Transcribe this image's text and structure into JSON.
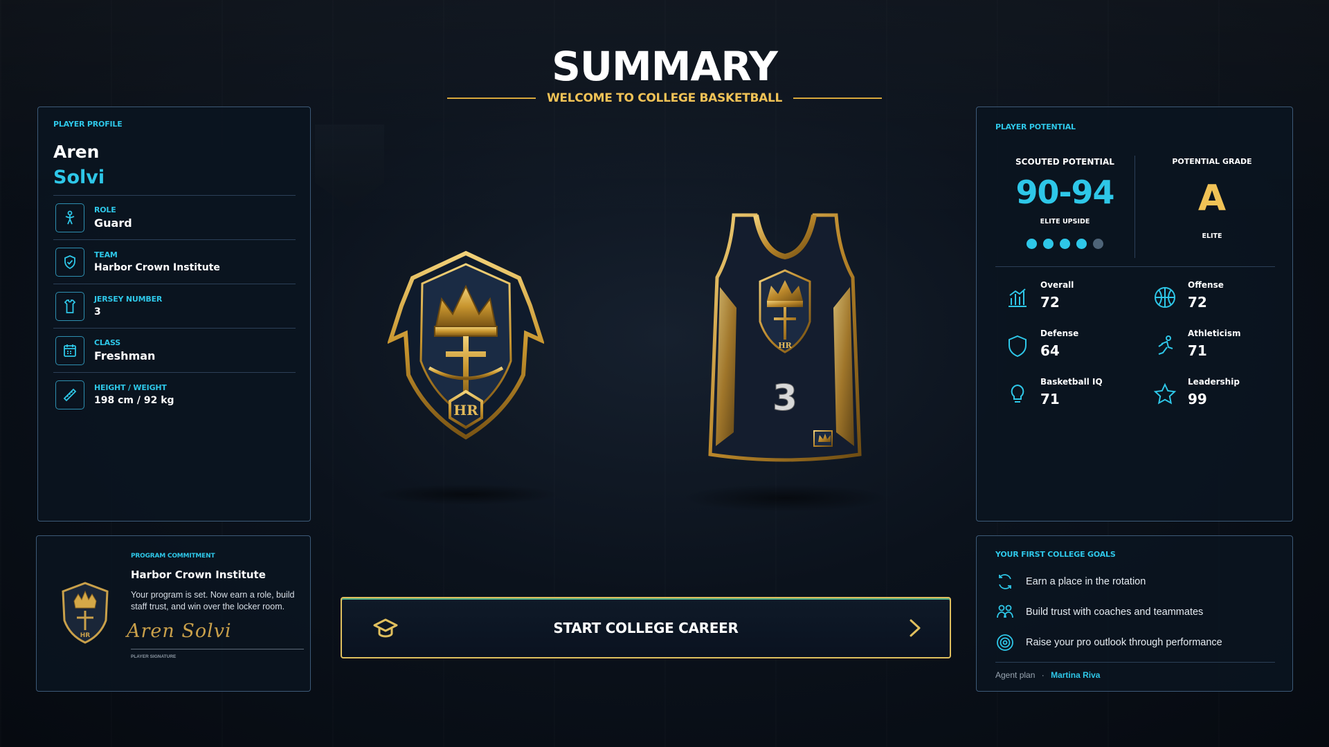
{
  "header": {
    "title": "SUMMARY",
    "subtitle": "WELCOME TO COLLEGE BASKETBALL"
  },
  "profile": {
    "section_label": "PLAYER PROFILE",
    "first_name": "Aren",
    "last_name": "Solvi",
    "rows": [
      {
        "label": "ROLE",
        "value": "Guard",
        "icon": "guard-icon"
      },
      {
        "label": "TEAM",
        "value": "Harbor Crown Institute",
        "icon": "shield-check-icon"
      },
      {
        "label": "JERSEY NUMBER",
        "value": "3",
        "icon": "jersey-icon"
      },
      {
        "label": "CLASS",
        "value": "Freshman",
        "icon": "calendar-icon"
      },
      {
        "label": "HEIGHT / WEIGHT",
        "value": "198 cm / 92 kg",
        "icon": "ruler-icon"
      }
    ]
  },
  "commitment": {
    "label": "PROGRAM COMMITMENT",
    "team": "Harbor Crown Institute",
    "description": "Your program is set. Now earn a role, build staff trust, and win over the locker room.",
    "signature": "Aren Solvi",
    "signature_label": "PLAYER SIGNATURE",
    "crest_initials": "HR"
  },
  "center": {
    "crest_initials": "HR",
    "jersey_number": "3",
    "jersey_crest_initials": "HR"
  },
  "potential": {
    "section_label": "PLAYER POTENTIAL",
    "scouted_label": "SCOUTED POTENTIAL",
    "scouted_range": "90-94",
    "scouted_tag": "ELITE UPSIDE",
    "stars_filled": 4,
    "stars_total": 5,
    "grade_label": "POTENTIAL GRADE",
    "grade": "A",
    "grade_tag": "ELITE",
    "attributes": [
      {
        "name": "Overall",
        "value": "72",
        "icon": "bar-chart-icon"
      },
      {
        "name": "Offense",
        "value": "72",
        "icon": "basketball-icon"
      },
      {
        "name": "Defense",
        "value": "64",
        "icon": "shield-icon"
      },
      {
        "name": "Athleticism",
        "value": "71",
        "icon": "running-icon"
      },
      {
        "name": "Basketball IQ",
        "value": "71",
        "icon": "lightbulb-icon"
      },
      {
        "name": "Leadership",
        "value": "99",
        "icon": "star-icon"
      }
    ]
  },
  "goals": {
    "section_label": "YOUR FIRST COLLEGE GOALS",
    "items": [
      {
        "text": "Earn a place in the rotation",
        "icon": "refresh-icon"
      },
      {
        "text": "Build trust with coaches and teammates",
        "icon": "people-icon"
      },
      {
        "text": "Raise your pro outlook through performance",
        "icon": "target-icon"
      }
    ],
    "agent_label": "Agent plan",
    "agent_separator": "·",
    "agent_name": "Martina Riva"
  },
  "start_button": {
    "label": "START COLLEGE CAREER"
  },
  "colors": {
    "accent_cyan": "#2ec7e8",
    "accent_gold": "#f0c256",
    "panel_border": "#3d5a78"
  }
}
